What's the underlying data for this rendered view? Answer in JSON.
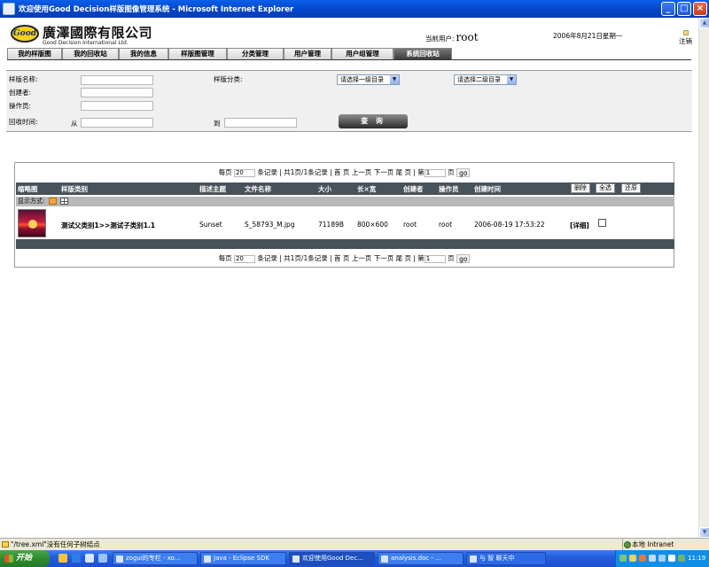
{
  "window": {
    "title": "欢迎使用Good Decision样版图像管理系统 - Microsoft Internet Explorer",
    "min_glyph": "_",
    "max_glyph": "□",
    "close_glyph": "×"
  },
  "header": {
    "logo_text": "Good",
    "company_cn": "廣澤國際有限公司",
    "company_en": "Good Decision International Ltd.",
    "current_user_label": "当前用户:",
    "current_user": "root",
    "date": "2006年8月21日星期一",
    "logout_label": "注销"
  },
  "tabs": [
    {
      "label": "我的样版图",
      "active": false
    },
    {
      "label": "我的回收站",
      "active": false
    },
    {
      "label": "我的信息",
      "active": false
    },
    {
      "label": "样版图管理",
      "active": false
    },
    {
      "label": "分类管理",
      "active": false
    },
    {
      "label": "用户管理",
      "active": false
    },
    {
      "label": "用户组管理",
      "active": false
    },
    {
      "label": "系统回收站",
      "active": true
    }
  ],
  "search": {
    "name_label": "样版名称:",
    "category_label": "样版分类:",
    "level1_select": "请选择一级目录",
    "level2_select": "请选择二级目录",
    "creator_label": "创建者:",
    "operator_label": "操作员:",
    "recycle_time_label": "回收时间:",
    "from_label": "从",
    "to_label": "到",
    "query_button": "查 询"
  },
  "pager": {
    "per_page_label": "每页",
    "per_page_value": "20",
    "records_label": "条记录",
    "total_text": "共1页/1条记录",
    "first": "首 页",
    "prev": "上一页",
    "next": "下一页",
    "last": "尾 页",
    "page_prefix": "第",
    "page_value": "1",
    "page_suffix": "页",
    "go": "go"
  },
  "table": {
    "headers": {
      "thumb": "缩略图",
      "category": "样版类别",
      "topic": "描述主题",
      "filename": "文件名称",
      "size": "大小",
      "dims": "长×宽",
      "creator": "创建者",
      "operator": "操作员",
      "created": "创建时间"
    },
    "buttons": {
      "delete": "删除",
      "select_all": "全选",
      "restore": "还原"
    },
    "display_mode_label": "显示方式:",
    "rows": [
      {
        "category": "测试父类别1>>测试子类别1.1",
        "topic": "Sunset",
        "filename": "S_58793_M.jpg",
        "size": "71189B",
        "dims": "800×600",
        "creator": "root",
        "operator": "root",
        "created": "2006-08-19 17:53:22",
        "detail": "[详细]",
        "checked": false
      }
    ]
  },
  "statusbar": {
    "message": "\"/tree.xml\"没有任何子树结点",
    "zone": "本地 Intranet"
  },
  "taskbar": {
    "start": "开始",
    "tasks": [
      {
        "label": "zogui的专栏 - xo...",
        "active": false
      },
      {
        "label": "Java - Eclipse SDK",
        "active": false
      },
      {
        "label": "欢迎使用Good Dec...",
        "active": true
      },
      {
        "label": "analysis.doc - ...",
        "active": false
      }
    ],
    "ime": "与 智 聊天中",
    "clock": "11:19"
  },
  "colors": {
    "tab_active": "#4a4a4a",
    "table_header": "#47525b",
    "xp_blue": "#245ede"
  }
}
